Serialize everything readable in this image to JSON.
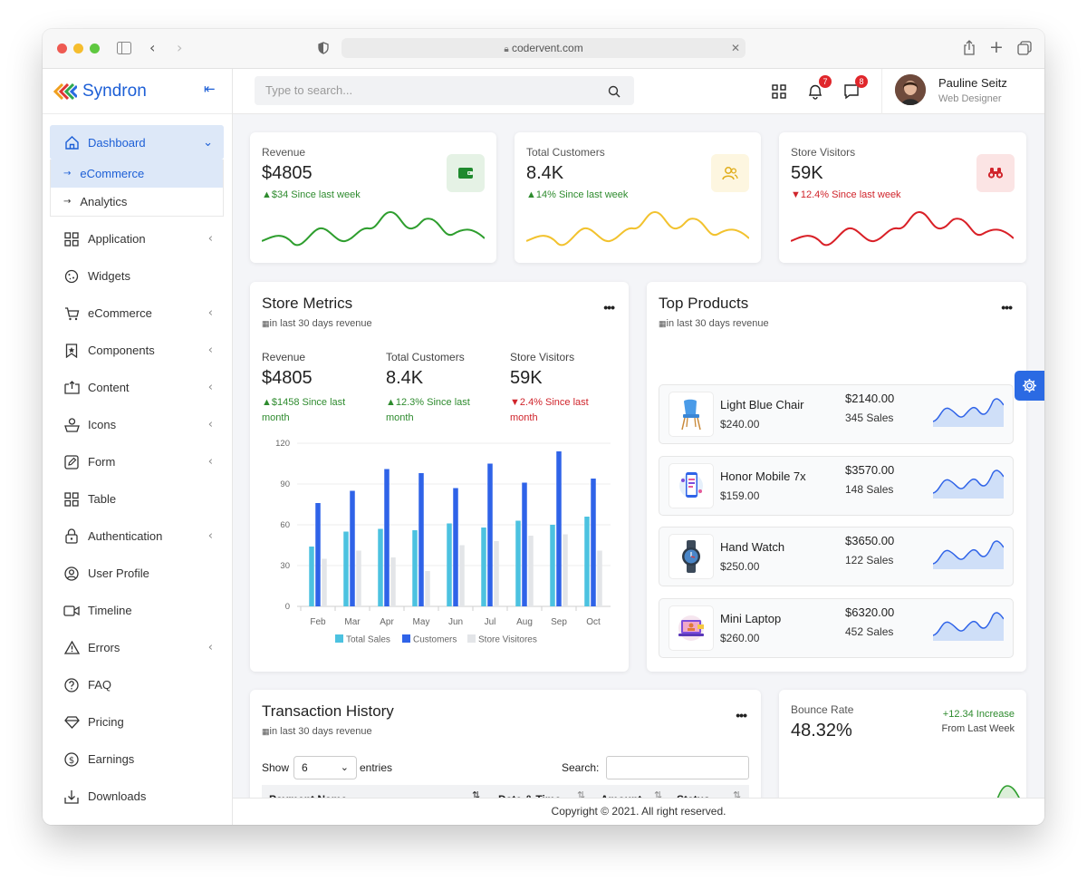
{
  "browser": {
    "url": "codervent.com"
  },
  "brand": {
    "name": "Syndron"
  },
  "sidebar": {
    "items": [
      {
        "label": "Dashboard",
        "icon": "home-icon",
        "active": true,
        "expanded": true
      },
      {
        "label": "Application",
        "icon": "grid-icon",
        "has_children": true
      },
      {
        "label": "Widgets",
        "icon": "cookie-icon"
      },
      {
        "label": "eCommerce",
        "icon": "cart-icon",
        "has_children": true
      },
      {
        "label": "Components",
        "icon": "bookmark-star-icon",
        "has_children": true
      },
      {
        "label": "Content",
        "icon": "box-arrow-icon",
        "has_children": true
      },
      {
        "label": "Icons",
        "icon": "basket-icon",
        "has_children": true
      },
      {
        "label": "Form",
        "icon": "pencil-square-icon",
        "has_children": true
      },
      {
        "label": "Table",
        "icon": "table-grid-icon"
      },
      {
        "label": "Authentication",
        "icon": "lock-icon",
        "has_children": true
      },
      {
        "label": "User Profile",
        "icon": "person-circle-icon"
      },
      {
        "label": "Timeline",
        "icon": "camera-video-icon"
      },
      {
        "label": "Errors",
        "icon": "warning-icon",
        "has_children": true
      },
      {
        "label": "FAQ",
        "icon": "question-circle-icon"
      },
      {
        "label": "Pricing",
        "icon": "diamond-icon"
      },
      {
        "label": "Earnings",
        "icon": "dollar-circle-icon"
      },
      {
        "label": "Downloads",
        "icon": "download-icon"
      }
    ],
    "dashboard_sub": [
      {
        "label": "eCommerce",
        "active": true
      },
      {
        "label": "Analytics",
        "active": false
      }
    ]
  },
  "header": {
    "search_placeholder": "Type to search...",
    "notifications_count": "7",
    "messages_count": "8",
    "user_name": "Pauline Seitz",
    "user_role": "Web Designer"
  },
  "stats": [
    {
      "label": "Revenue",
      "value": "$4805",
      "change": "$34 Since last week",
      "direction": "up",
      "color": "#2e9e2e",
      "icon": "wallet-icon"
    },
    {
      "label": "Total Customers",
      "value": "8.4K",
      "change": "14% Since last week",
      "direction": "up",
      "color": "#f2c22e",
      "icon": "users-icon"
    },
    {
      "label": "Store Visitors",
      "value": "59K",
      "change": "12.4% Since last week",
      "direction": "down",
      "color": "#d92027",
      "icon": "binoculars-icon"
    }
  ],
  "store_metrics": {
    "title": "Store Metrics",
    "subtitle": "in last 30 days revenue",
    "metrics": [
      {
        "label": "Revenue",
        "value": "$4805",
        "change": "$1458 Since last month",
        "direction": "up"
      },
      {
        "label": "Total Customers",
        "value": "8.4K",
        "change": "12.3% Since last month",
        "direction": "up"
      },
      {
        "label": "Store Visitors",
        "value": "59K",
        "change": "2.4% Since last month",
        "direction": "down"
      }
    ]
  },
  "chart_data": {
    "type": "bar",
    "categories": [
      "Feb",
      "Mar",
      "Apr",
      "May",
      "Jun",
      "Jul",
      "Aug",
      "Sep",
      "Oct"
    ],
    "series": [
      {
        "name": "Total Sales",
        "color": "#4cc2e0",
        "values": [
          44,
          55,
          57,
          56,
          61,
          58,
          63,
          60,
          66
        ]
      },
      {
        "name": "Customers",
        "color": "#2f63e8",
        "values": [
          76,
          85,
          101,
          98,
          87,
          105,
          91,
          114,
          94
        ]
      },
      {
        "name": "Store Visitores",
        "color": "#e3e5e8",
        "values": [
          35,
          41,
          36,
          26,
          45,
          48,
          52,
          53,
          41
        ]
      }
    ],
    "yticks": [
      "0",
      "30",
      "60",
      "90",
      "120"
    ],
    "ylim": [
      0,
      120
    ],
    "grid": true,
    "legend_position": "bottom"
  },
  "top_products": {
    "title": "Top Products",
    "subtitle": "in last 30 days revenue",
    "items": [
      {
        "name": "Light Blue Chair",
        "price": "$240.00",
        "total": "$2140.00",
        "sales": "345 Sales",
        "icon": "chair-icon"
      },
      {
        "name": "Honor Mobile 7x",
        "price": "$159.00",
        "total": "$3570.00",
        "sales": "148 Sales",
        "icon": "mobile-icon"
      },
      {
        "name": "Hand Watch",
        "price": "$250.00",
        "total": "$3650.00",
        "sales": "122 Sales",
        "icon": "watch-icon"
      },
      {
        "name": "Mini Laptop",
        "price": "$260.00",
        "total": "$6320.00",
        "sales": "452 Sales",
        "icon": "laptop-icon"
      }
    ]
  },
  "transactions": {
    "title": "Transaction History",
    "subtitle": "in last 30 days revenue",
    "show_label": "Show",
    "entries_value": "6",
    "entries_label": "entries",
    "search_label": "Search:",
    "columns": [
      "Payment Name",
      "Date & Time",
      "Amount",
      "Status"
    ]
  },
  "bounce_rate": {
    "label": "Bounce Rate",
    "value": "48.32%",
    "change": "+12.34 Increase",
    "change_sub": "From Last Week",
    "color": "#2e9e2e"
  },
  "footer": {
    "text": "Copyright © 2021. All right reserved."
  }
}
